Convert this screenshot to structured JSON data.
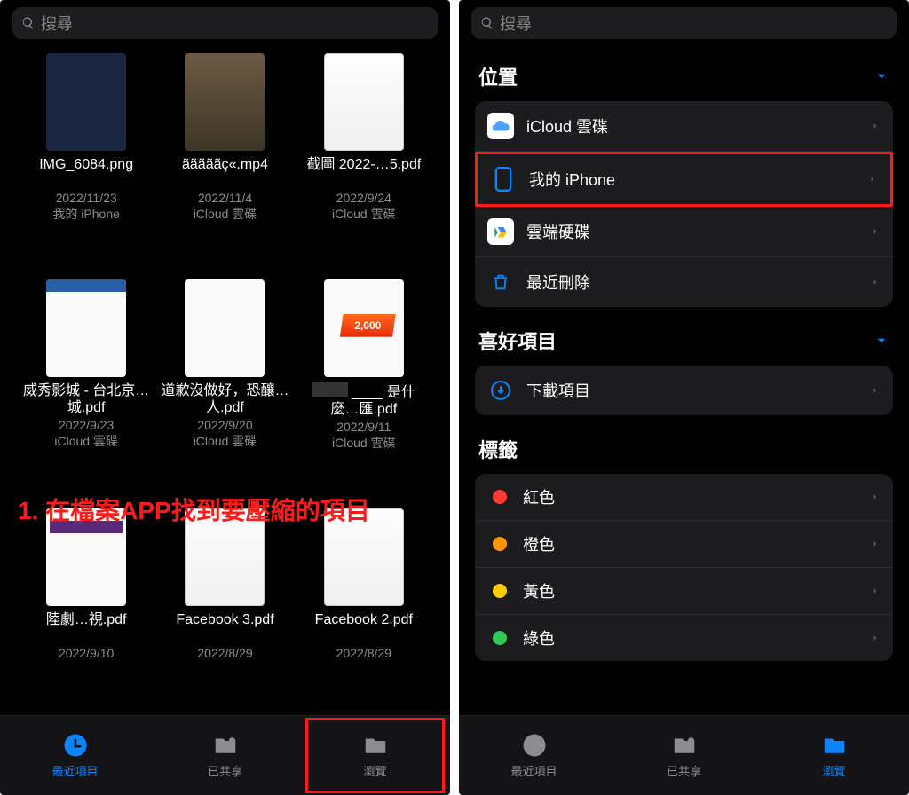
{
  "left": {
    "search_placeholder": "搜尋",
    "files": [
      {
        "name": "IMG_6084.png",
        "date": "2022/11/23",
        "loc": "我的 iPhone"
      },
      {
        "name": "ãããããç«.mp4",
        "date": "2022/11/4",
        "loc": "iCloud 雲碟"
      },
      {
        "name": "截圖 2022-…5.pdf",
        "date": "2022/9/24",
        "loc": "iCloud 雲碟"
      },
      {
        "name": "威秀影城 - 台北京…城.pdf",
        "date": "2022/9/23",
        "loc": "iCloud 雲碟"
      },
      {
        "name": "道歉沒做好，恐釀…人.pdf",
        "date": "2022/9/20",
        "loc": "iCloud 雲碟"
      },
      {
        "name": "____ 是什麼…匯.pdf",
        "date": "2022/9/11",
        "loc": "iCloud 雲碟"
      },
      {
        "name": "陸劇…視.pdf",
        "date": "2022/9/10",
        "loc": ""
      },
      {
        "name": "Facebook 3.pdf",
        "date": "2022/8/29",
        "loc": ""
      },
      {
        "name": "Facebook 2.pdf",
        "date": "2022/8/29",
        "loc": ""
      }
    ],
    "overlay": "1. 在檔案APP找到要壓縮的項目",
    "badge2000": "2,000",
    "tabs": {
      "recent": "最近項目",
      "shared": "已共享",
      "browse": "瀏覽"
    }
  },
  "right": {
    "search_placeholder": "搜尋",
    "sections": {
      "locations_title": "位置",
      "locations": [
        {
          "label": "iCloud 雲碟"
        },
        {
          "label": "我的 iPhone"
        },
        {
          "label": "雲端硬碟"
        },
        {
          "label": "最近刪除"
        }
      ],
      "favorites_title": "喜好項目",
      "favorites": [
        {
          "label": "下載項目"
        }
      ],
      "tags_title": "標籤",
      "tags": [
        {
          "label": "紅色",
          "color": "#ff3b30"
        },
        {
          "label": "橙色",
          "color": "#ff9500"
        },
        {
          "label": "黃色",
          "color": "#ffcc00"
        },
        {
          "label": "綠色",
          "color": "#34c759"
        }
      ]
    },
    "tabs": {
      "recent": "最近項目",
      "shared": "已共享",
      "browse": "瀏覽"
    }
  }
}
